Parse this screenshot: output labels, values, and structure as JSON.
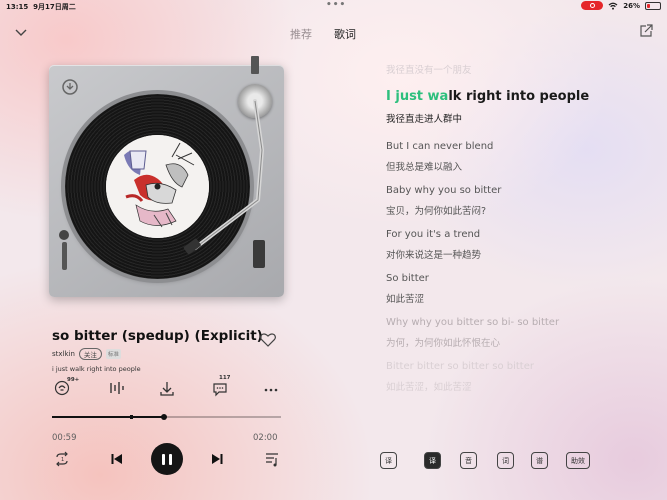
{
  "status": {
    "time": "13:15",
    "date": "9月17日周二",
    "battery": "26%",
    "colors": {
      "recording": "#e5262a"
    }
  },
  "nav": {
    "tabs": [
      {
        "label": "推荐",
        "active": false
      },
      {
        "label": "歌词",
        "active": true
      }
    ]
  },
  "song": {
    "title": "so bitter (spedup) (Explicit)",
    "artist": "stxlkin",
    "follow_label": "关注",
    "quality_badge": "标准",
    "current_line": "i just walk right into people",
    "comment_count": "117",
    "icon_badge": "99+",
    "current_time": "00:59",
    "total_time": "02:00",
    "progress": 0.49
  },
  "lyrics": {
    "highlight_color": "#2dbf7d",
    "lines": [
      {
        "text": "我径直没有一个朋友",
        "style": "faint"
      },
      {
        "text": "I just walk right into people",
        "style": "active",
        "highlight_part": "I just wa",
        "rest": "lk right into people"
      },
      {
        "text": "我径直走进人群中",
        "style": "active-zh"
      },
      {
        "text": "But I can never blend",
        "style": "en"
      },
      {
        "text": "但我总是难以融入",
        "style": "zh"
      },
      {
        "text": "Baby why you so bitter",
        "style": "en"
      },
      {
        "text": "宝贝，为何你如此苦闷?",
        "style": "zh"
      },
      {
        "text": "For you it's a trend",
        "style": "en"
      },
      {
        "text": "对你来说这是一种趋势",
        "style": "zh"
      },
      {
        "text": "So bitter",
        "style": "en"
      },
      {
        "text": "如此苦涩",
        "style": "zh"
      },
      {
        "text": "Why why you bitter so bi- so bitter",
        "style": "faded"
      },
      {
        "text": "为何，为何你如此怀恨在心",
        "style": "faded"
      },
      {
        "text": "Bitter bitter so bitter so bitter",
        "style": "faint"
      },
      {
        "text": "如此苦涩，如此苦涩",
        "style": "faint"
      }
    ]
  },
  "lyric_tools": {
    "t1": "译",
    "t2": "译",
    "t3": "音",
    "t4": "词",
    "t5": "谱",
    "t6": "助效"
  }
}
